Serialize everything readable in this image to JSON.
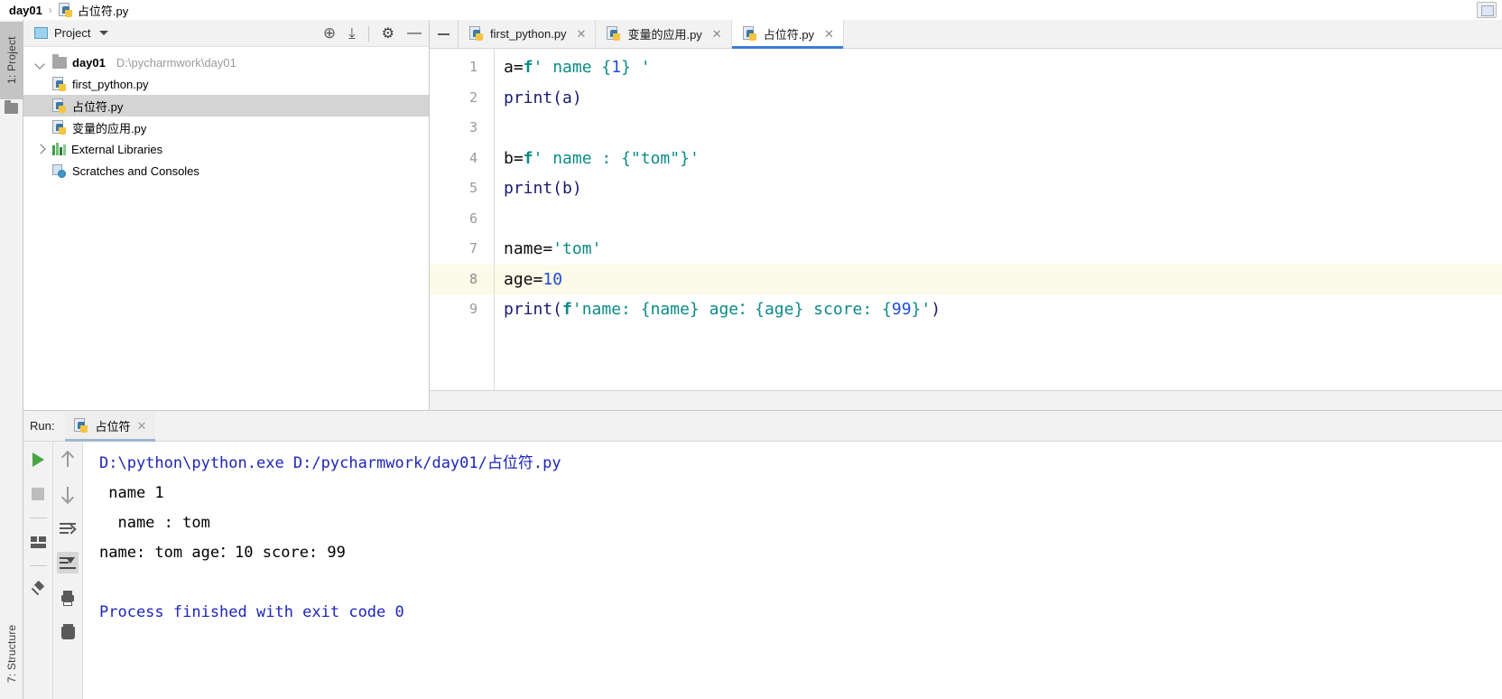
{
  "breadcrumb": {
    "root": "day01",
    "separator": "›",
    "leaf": "占位符.py",
    "leaf_icon": "python-file-icon"
  },
  "left_strip": {
    "project_tab": "1: Project",
    "structure_tab": "7: Structure",
    "folder_icon": "folder-icon"
  },
  "project_panel": {
    "title": "Project",
    "window_icon": "project-window-icon",
    "caret_icon": "chevron-down-icon",
    "tools": [
      {
        "name": "locate-icon",
        "glyph": "⊕"
      },
      {
        "name": "collapse-all-icon",
        "glyph": "⤓"
      },
      {
        "name": "settings-gear-icon",
        "glyph": "⚙"
      },
      {
        "name": "hide-panel-icon",
        "glyph": "—"
      }
    ],
    "tree": [
      {
        "label": "day01",
        "path": "D:\\pycharmwork\\day01",
        "icon": "folder-icon",
        "arrow": "down",
        "bold": true,
        "selected": false
      },
      {
        "label": "first_python.py",
        "path": "",
        "icon": "python-file-icon",
        "arrow": "none",
        "bold": false,
        "selected": false
      },
      {
        "label": "占位符.py",
        "path": "",
        "icon": "python-file-icon",
        "arrow": "none",
        "bold": false,
        "selected": true
      },
      {
        "label": "变量的应用.py",
        "path": "",
        "icon": "python-file-icon",
        "arrow": "none",
        "bold": false,
        "selected": false
      },
      {
        "label": "External Libraries",
        "path": "",
        "icon": "libraries-icon",
        "arrow": "right",
        "bold": false,
        "selected": false
      },
      {
        "label": "Scratches and Consoles",
        "path": "",
        "icon": "scratches-icon",
        "arrow": "none",
        "bold": false,
        "selected": false
      }
    ]
  },
  "editor": {
    "minimize_icon": "minimize-icon",
    "tabs": [
      {
        "label": "first_python.py",
        "icon": "python-file-icon",
        "close": "✕",
        "active": false
      },
      {
        "label": "变量的应用.py",
        "icon": "python-file-icon",
        "close": "✕",
        "active": false
      },
      {
        "label": "占位符.py",
        "icon": "python-file-icon",
        "close": "✕",
        "active": true
      }
    ],
    "gutter": [
      "1",
      "2",
      "3",
      "4",
      "5",
      "6",
      "7",
      "8",
      "9"
    ],
    "current_line": 8,
    "lines": [
      {
        "n": "1",
        "tokens": [
          {
            "t": "a=",
            "c": "plain"
          },
          {
            "t": "f",
            "c": "fpre"
          },
          {
            "t": "' name ",
            "c": "str"
          },
          {
            "t": "{",
            "c": "brace"
          },
          {
            "t": "1",
            "c": "num"
          },
          {
            "t": "}",
            "c": "brace"
          },
          {
            "t": " '",
            "c": "str"
          }
        ]
      },
      {
        "n": "2",
        "tokens": [
          {
            "t": "print(a)",
            "c": "fn"
          }
        ]
      },
      {
        "n": "3",
        "tokens": []
      },
      {
        "n": "4",
        "tokens": [
          {
            "t": "b=",
            "c": "plain"
          },
          {
            "t": "f",
            "c": "fpre"
          },
          {
            "t": "' name : ",
            "c": "str"
          },
          {
            "t": "{",
            "c": "brace"
          },
          {
            "t": "\"tom\"",
            "c": "str"
          },
          {
            "t": "}",
            "c": "brace"
          },
          {
            "t": "'",
            "c": "str"
          }
        ]
      },
      {
        "n": "5",
        "tokens": [
          {
            "t": "print(b)",
            "c": "fn"
          }
        ]
      },
      {
        "n": "6",
        "tokens": []
      },
      {
        "n": "7",
        "tokens": [
          {
            "t": "name=",
            "c": "plain"
          },
          {
            "t": "'tom'",
            "c": "str"
          }
        ]
      },
      {
        "n": "8",
        "tokens": [
          {
            "t": "age=",
            "c": "plain"
          },
          {
            "t": "10",
            "c": "num"
          }
        ]
      },
      {
        "n": "9",
        "tokens": [
          {
            "t": "print(",
            "c": "fn"
          },
          {
            "t": "f",
            "c": "fpre"
          },
          {
            "t": "'name: ",
            "c": "str"
          },
          {
            "t": "{name}",
            "c": "brace"
          },
          {
            "t": " age：",
            "c": "str"
          },
          {
            "t": "{age}",
            "c": "brace"
          },
          {
            "t": " score: ",
            "c": "str"
          },
          {
            "t": "{",
            "c": "brace"
          },
          {
            "t": "99",
            "c": "num"
          },
          {
            "t": "}",
            "c": "brace"
          },
          {
            "t": "'",
            "c": "str"
          },
          {
            "t": ")",
            "c": "fn"
          }
        ]
      }
    ]
  },
  "run_panel": {
    "label": "Run:",
    "tab_label": "占位符",
    "tab_icon": "python-file-icon",
    "tab_close": "✕",
    "toolbar_left": [
      {
        "name": "run-button",
        "icon": "play-icon"
      },
      {
        "name": "stop-button",
        "icon": "stop-icon"
      },
      {
        "name": "layout-button",
        "icon": "layout-icon"
      },
      {
        "name": "pin-tab-button",
        "icon": "pin-icon"
      }
    ],
    "toolbar_right": [
      {
        "name": "up-the-stack-button",
        "icon": "arrow-up-icon"
      },
      {
        "name": "down-the-stack-button",
        "icon": "arrow-down-icon"
      },
      {
        "name": "soft-wrap-button",
        "icon": "soft-wrap-icon"
      },
      {
        "name": "scroll-to-end-button",
        "icon": "scroll-to-end-icon"
      },
      {
        "name": "print-button",
        "icon": "print-icon"
      },
      {
        "name": "clear-all-button",
        "icon": "trash-icon"
      }
    ],
    "console": [
      {
        "text": "D:\\python\\python.exe D:/pycharmwork/day01/占位符.py",
        "style": "cmd"
      },
      {
        "text": " name 1",
        "style": "out"
      },
      {
        "text": "  name : tom",
        "style": "out"
      },
      {
        "text": "name: tom age：10 score: 99",
        "style": "out"
      },
      {
        "text": "",
        "style": "out"
      },
      {
        "text": "Process finished with exit code 0",
        "style": "fin"
      }
    ]
  },
  "colors": {
    "accent_tab": "#3b7dd8",
    "string": "#0c8a86",
    "number": "#1f4ed8",
    "function": "#1a1a6e",
    "console_cmd": "#1d25b8",
    "selection": "#d4d4d4",
    "current_line": "#fcfae8"
  }
}
